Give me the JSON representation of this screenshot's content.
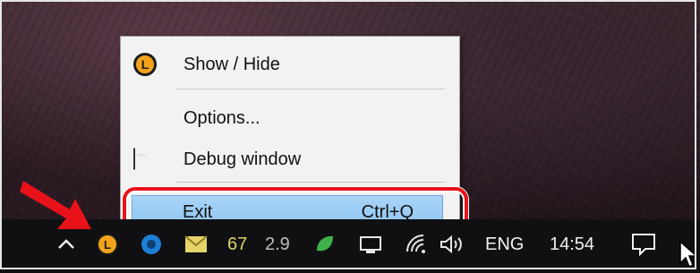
{
  "menu": {
    "items": [
      {
        "label": "Show / Hide",
        "icon": "app-logo-icon"
      },
      {
        "label": "Options...",
        "icon": ""
      },
      {
        "label": "Debug window",
        "icon": "terminal-icon"
      },
      {
        "label": "Exit",
        "shortcut": "Ctrl+Q",
        "highlighted": true
      }
    ]
  },
  "app_icon_letter": "L",
  "taskbar": {
    "tray_numbers": [
      "67",
      "2.9"
    ],
    "language": "ENG",
    "time": "14:54"
  },
  "colors": {
    "highlight_ring": "#e8121b",
    "menu_hover": "#99c9f2",
    "app_icon": "#f2a31b",
    "taskbar": "#101012"
  }
}
